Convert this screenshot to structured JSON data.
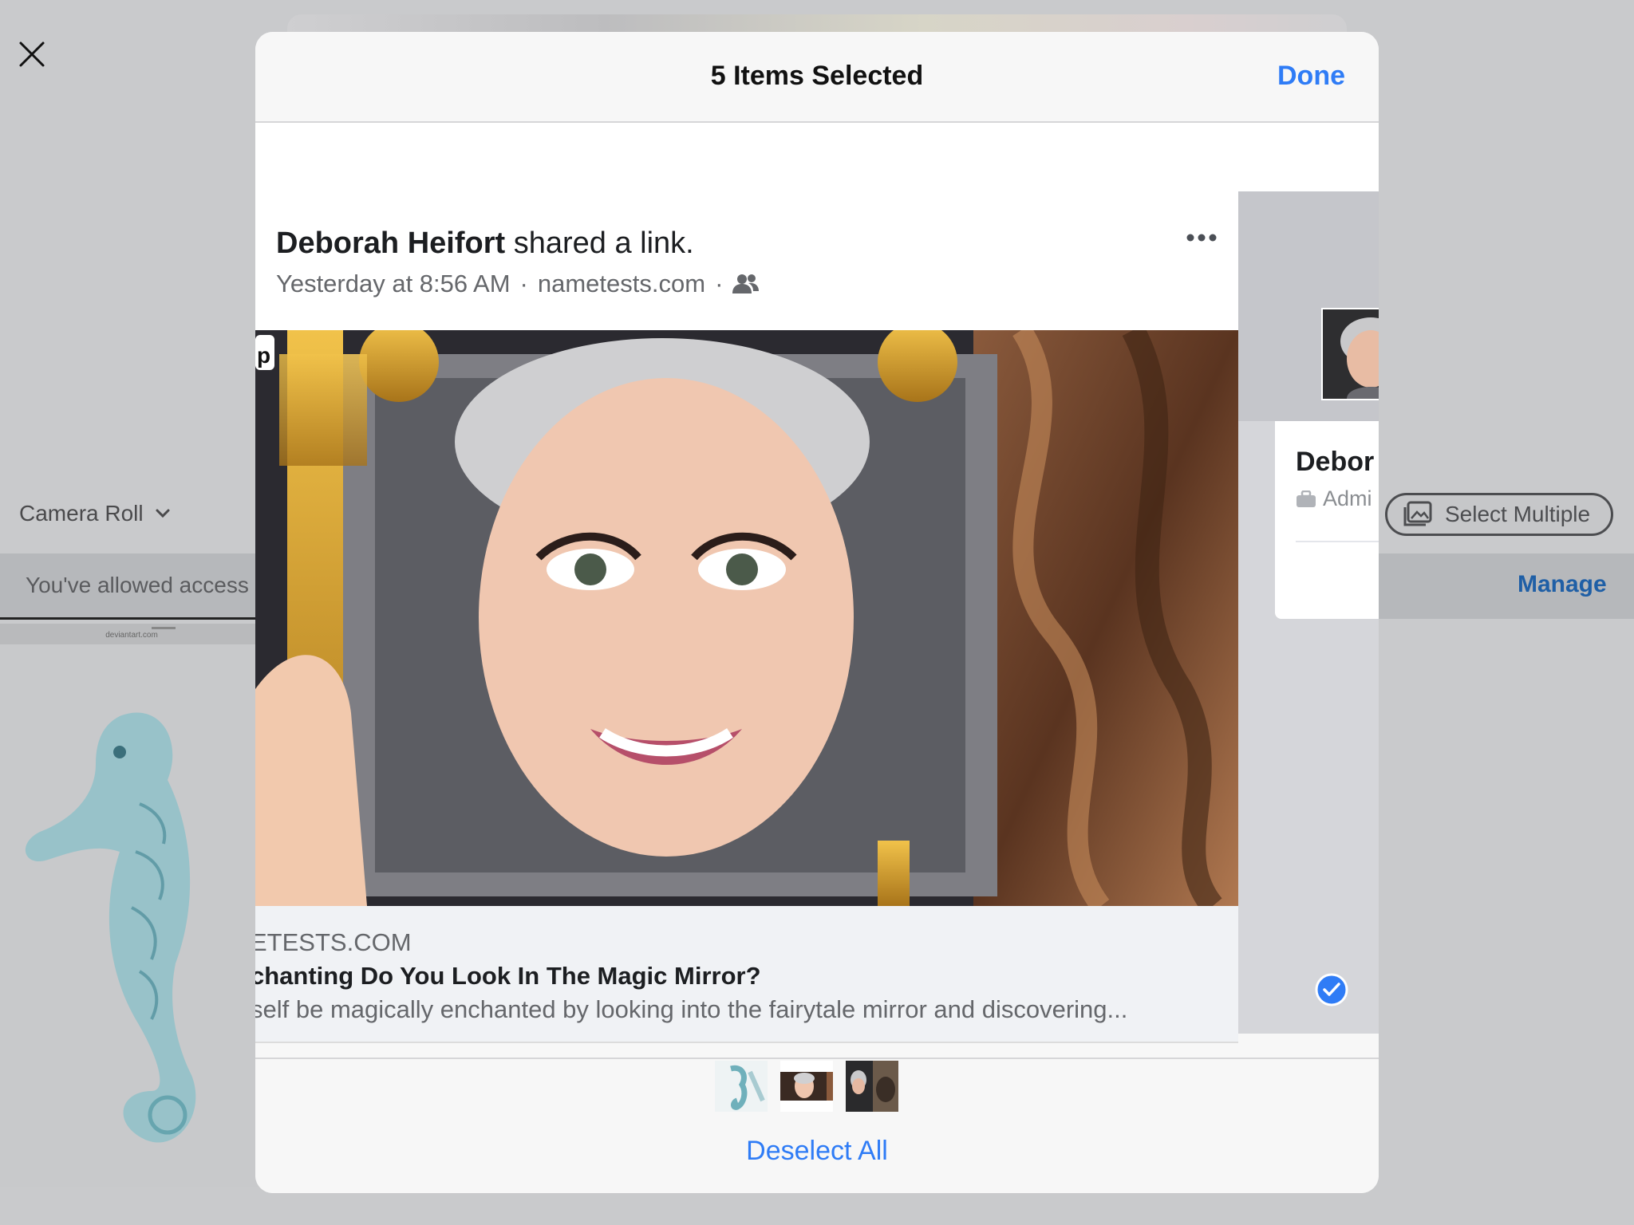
{
  "background": {
    "camera_roll_label": "Camera Roll",
    "access_notice": "You've allowed access",
    "manage_label": "Manage",
    "select_multiple_label": "Select Multiple",
    "thumb_caption": "deviantart.com"
  },
  "sheet": {
    "title": "5 Items Selected",
    "done_label": "Done",
    "deselect_all_label": "Deselect All"
  },
  "post": {
    "author": "Deborah Heifort",
    "action": " shared a link.",
    "time": "Yesterday at 8:56 AM",
    "separator": "·",
    "domain": "nametests.com",
    "link_domain": "ETESTS.COM",
    "link_title": "chanting Do You Look In The Magic Mirror?",
    "link_description": "self be magically enchanted by looking into the fairytale mirror and discovering...",
    "image_corner_letter": "p"
  },
  "peek": {
    "name": "Debor",
    "role": "Admi"
  },
  "colors": {
    "accent": "#2f7cf6",
    "manage": "#1f5fa6"
  },
  "icons": {
    "close": "close-icon",
    "chevron": "chevron-down-icon",
    "friends": "friends-icon",
    "more": "more-dots-icon",
    "check": "checkmark-circle-icon",
    "select_multiple": "photo-stack-icon",
    "briefcase": "briefcase-icon"
  }
}
